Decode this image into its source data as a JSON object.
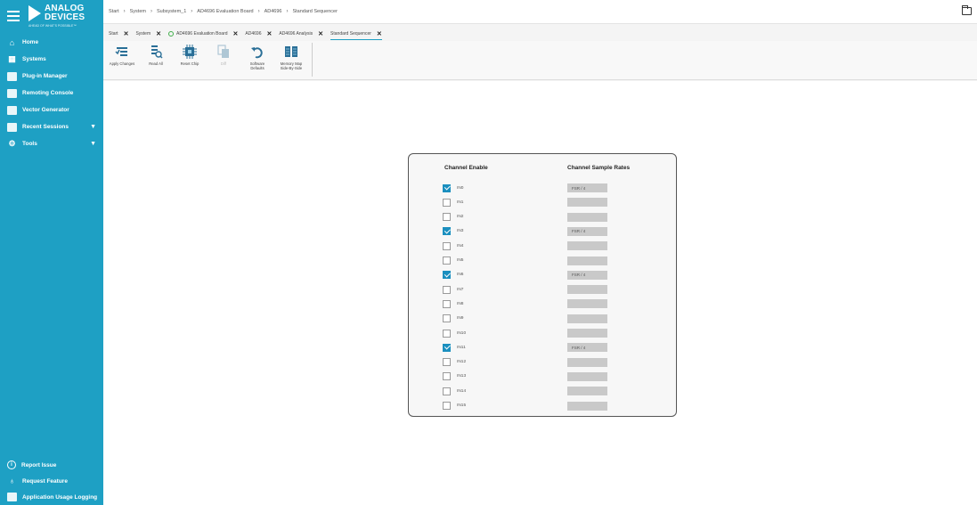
{
  "sidebar": {
    "logo_line1": "ANALOG",
    "logo_line2": "DEVICES",
    "logo_tagline": "AHEAD OF WHAT'S POSSIBLE™",
    "items": [
      {
        "label": "Home"
      },
      {
        "label": "Systems"
      },
      {
        "label": "Plug-in Manager"
      },
      {
        "label": "Remoting Console"
      },
      {
        "label": "Vector Generator"
      },
      {
        "label": "Recent Sessions"
      },
      {
        "label": "Tools"
      }
    ],
    "bottom": [
      {
        "label": "Report Issue"
      },
      {
        "label": "Request Feature"
      },
      {
        "label": "Application Usage Logging"
      }
    ]
  },
  "breadcrumb": [
    "Start",
    "System",
    "Subsystem_1",
    "AD4696 Evaluation Board",
    "AD4696",
    "Standard Sequencer"
  ],
  "tabs": [
    {
      "label": "Start"
    },
    {
      "label": "System"
    },
    {
      "label": "AD4696 Evaluation Board"
    },
    {
      "label": "AD4696"
    },
    {
      "label": "AD4696 Analysis"
    },
    {
      "label": "Standard Sequencer"
    }
  ],
  "toolbar": {
    "apply_changes": "Apply Changes",
    "read_all": "Read All",
    "reset_chip": "Reset Chip",
    "diff": "Diff",
    "software_defaults": "Software Defaults",
    "memory_map": "Memory Map Side-By-Side"
  },
  "panel": {
    "channel_enable_header": "Channel Enable",
    "sample_rates_header": "Channel Sample Rates",
    "channels": [
      {
        "label": "IN0",
        "enabled": true,
        "rate": "FSR / 4"
      },
      {
        "label": "IN1",
        "enabled": false,
        "rate": ""
      },
      {
        "label": "IN2",
        "enabled": false,
        "rate": ""
      },
      {
        "label": "IN3",
        "enabled": true,
        "rate": "FSR / 4"
      },
      {
        "label": "IN4",
        "enabled": false,
        "rate": ""
      },
      {
        "label": "IN5",
        "enabled": false,
        "rate": ""
      },
      {
        "label": "IN6",
        "enabled": true,
        "rate": "FSR / 4"
      },
      {
        "label": "IN7",
        "enabled": false,
        "rate": ""
      },
      {
        "label": "IN8",
        "enabled": false,
        "rate": ""
      },
      {
        "label": "IN9",
        "enabled": false,
        "rate": ""
      },
      {
        "label": "IN10",
        "enabled": false,
        "rate": ""
      },
      {
        "label": "IN11",
        "enabled": true,
        "rate": "FSR / 4"
      },
      {
        "label": "IN12",
        "enabled": false,
        "rate": ""
      },
      {
        "label": "IN13",
        "enabled": false,
        "rate": ""
      },
      {
        "label": "IN14",
        "enabled": false,
        "rate": ""
      },
      {
        "label": "IN15",
        "enabled": false,
        "rate": ""
      }
    ]
  },
  "colors": {
    "accent": "#1ea0c4",
    "checkbox": "#1b8fbf",
    "ok": "#3fae49"
  }
}
